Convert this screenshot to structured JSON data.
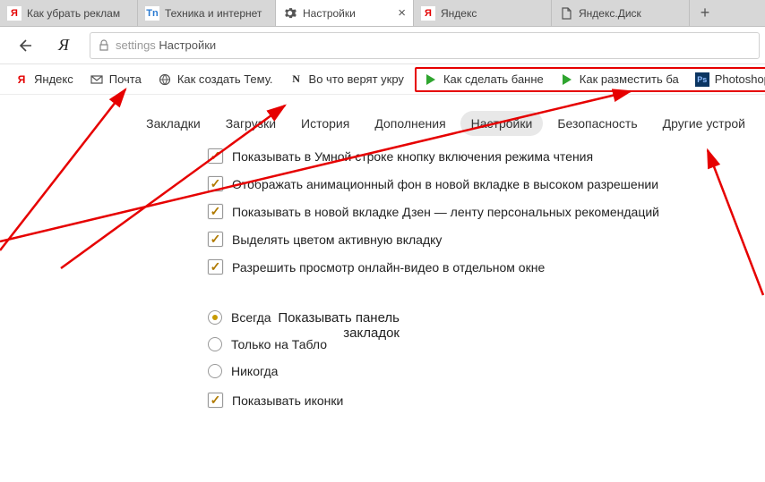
{
  "tabs": [
    {
      "title": "Как убрать реклам"
    },
    {
      "title": "Техника и интернет"
    },
    {
      "title": "Настройки"
    },
    {
      "title": "Яндекс"
    },
    {
      "title": "Яндекс.Диск"
    }
  ],
  "omnibox": {
    "prefix": "settings ",
    "label": "Настройки"
  },
  "bookmarks": [
    {
      "label": "Яндекс"
    },
    {
      "label": "Почта"
    },
    {
      "label": "Как создать Тему."
    },
    {
      "label": "Во что верят укру"
    }
  ],
  "bookmarks_highlighted": [
    {
      "label": "Как сделать банне"
    },
    {
      "label": "Как разместить ба"
    },
    {
      "label": "Photoshop"
    }
  ],
  "content_nav": [
    "Закладки",
    "Загрузки",
    "История",
    "Дополнения",
    "Настройки",
    "Безопасность",
    "Другие устрой"
  ],
  "content_nav_active": 4,
  "checks": [
    "Показывать в Умной строке кнопку включения режима чтения",
    "Отображать анимационный фон в новой вкладке в высоком разрешении",
    "Показывать в новой вкладке Дзен — ленту персональных рекомендаций",
    "Выделять цветом активную вкладку",
    "Разрешить просмотр онлайн-видео в отдельном окне"
  ],
  "section_label_l1": "Показывать панель",
  "section_label_l2": "закладок",
  "radios": [
    {
      "label": "Всегда",
      "selected": true
    },
    {
      "label": "Только на Табло",
      "selected": false
    },
    {
      "label": "Никогда",
      "selected": false
    }
  ],
  "show_icons_label": "Показывать иконки"
}
